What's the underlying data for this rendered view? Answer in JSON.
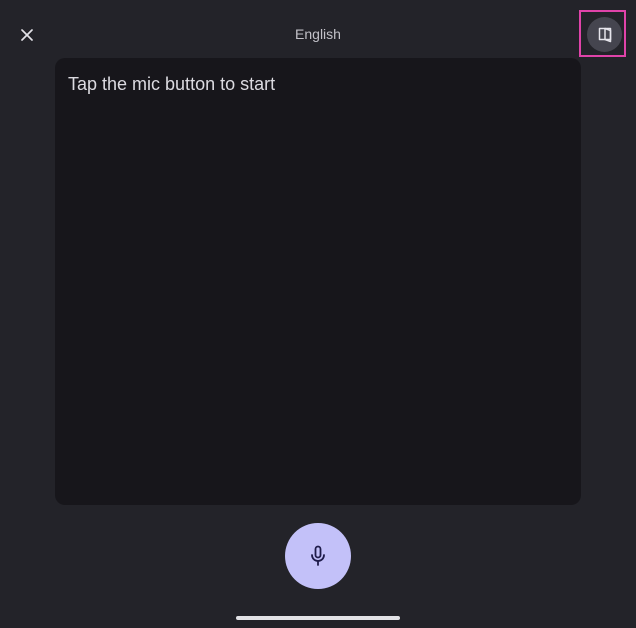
{
  "header": {
    "title": "English",
    "close_icon": "close-icon",
    "mode_icon": "book-open-icon"
  },
  "transcript": {
    "prompt": "Tap the mic button to start"
  },
  "controls": {
    "mic_icon": "mic-icon"
  },
  "colors": {
    "background": "#232329",
    "panel": "#17161b",
    "mic_button": "#c3c1f9",
    "highlight": "#e043a9"
  }
}
